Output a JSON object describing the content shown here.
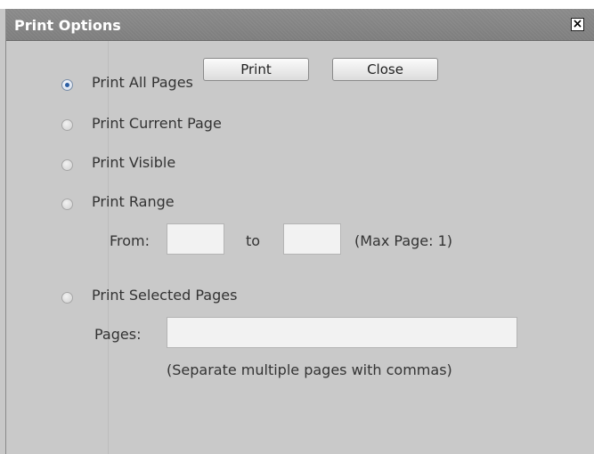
{
  "dialog": {
    "title": "Print Options",
    "close_glyph": "×",
    "print_button": "Print",
    "close_button": "Close"
  },
  "options": {
    "print_all": "Print All Pages",
    "print_current": "Print Current Page",
    "print_visible": "Print Visible",
    "print_range": "Print Range",
    "print_selected": "Print Selected Pages",
    "selected_option": "print_all"
  },
  "range": {
    "from_label": "From:",
    "to_label": "to",
    "max_page": "(Max Page: 1)",
    "from_value": "",
    "to_value": ""
  },
  "selected_pages": {
    "pages_label": "Pages:",
    "pages_value": "",
    "hint": "(Separate multiple pages with commas)"
  }
}
